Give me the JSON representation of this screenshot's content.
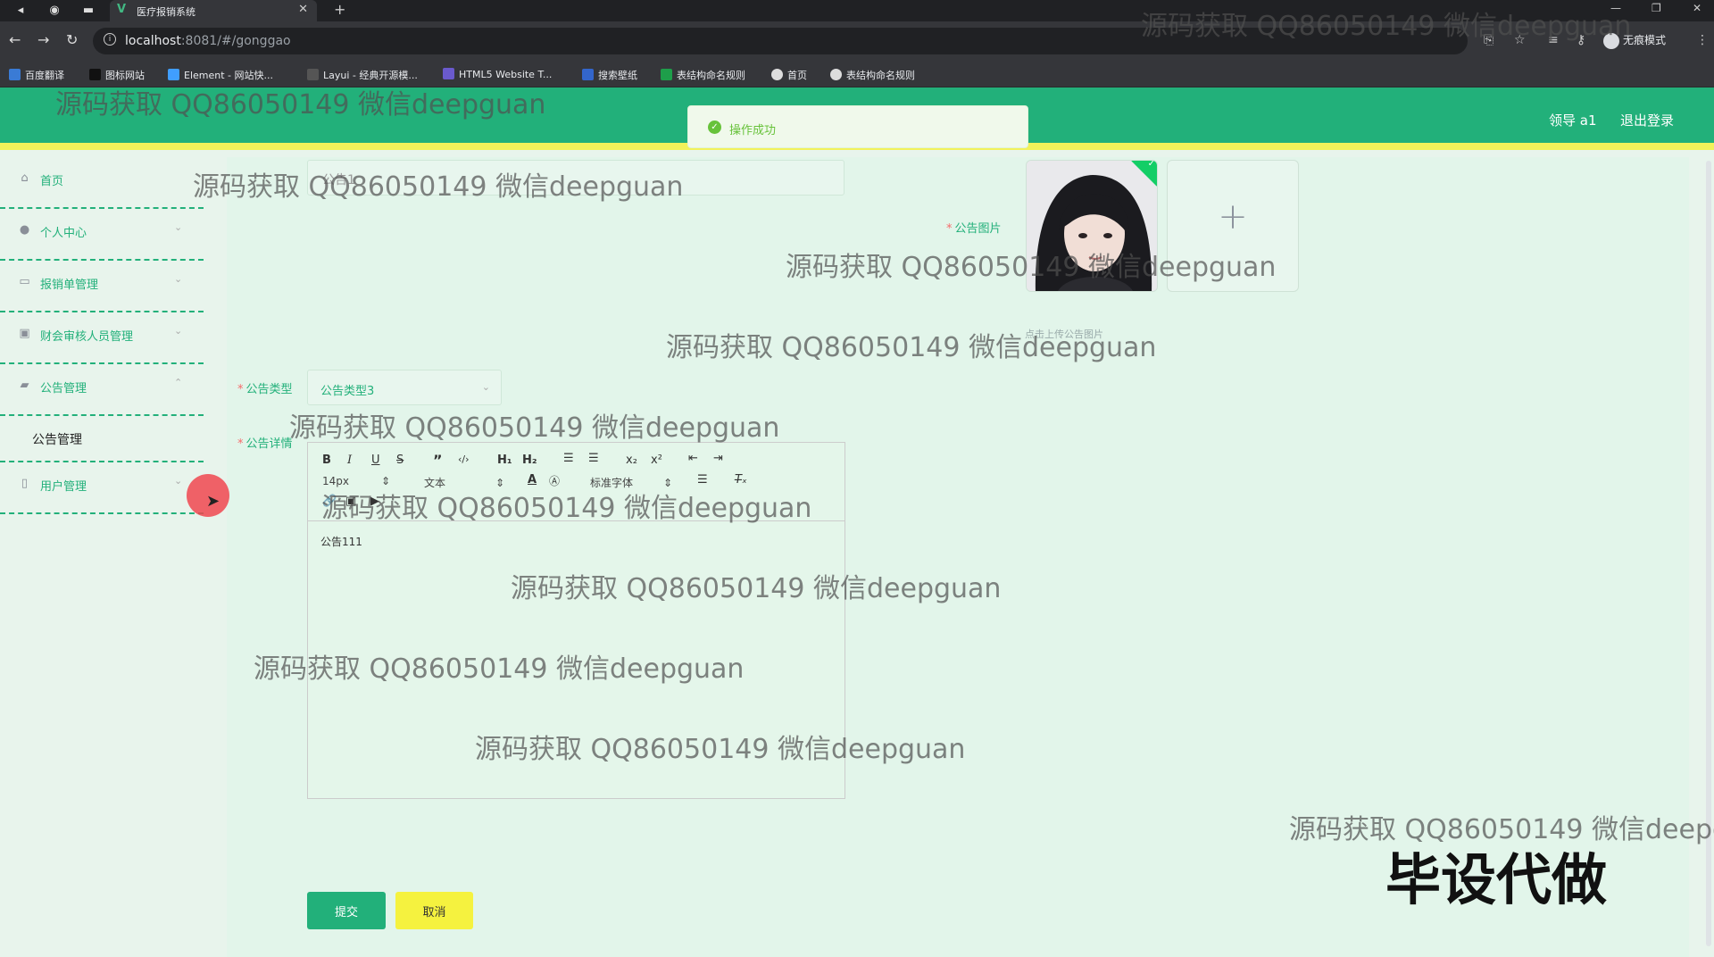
{
  "browser": {
    "tab_title": "医疗报销系统",
    "url_host": "localhost",
    "url_path": ":8081/#/gonggao",
    "profile_label": "无痕模式",
    "bookmarks": [
      "百度翻译",
      "图标网站",
      "Element - 网站快...",
      "Layui - 经典开源模...",
      "HTML5 Website T...",
      "搜索壁纸",
      "表结构命名规则",
      "首页",
      "表结构命名规则"
    ]
  },
  "header": {
    "user_label": "领导 a1",
    "logout_label": "退出登录",
    "accent_color": "#22b07a"
  },
  "toast": {
    "message": "操作成功",
    "status": "success"
  },
  "sidebar": {
    "items": [
      {
        "label": "首页",
        "icon": "home-icon"
      },
      {
        "label": "个人中心",
        "icon": "user-icon"
      },
      {
        "label": "报销单管理",
        "icon": "chat-icon"
      },
      {
        "label": "财会审核人员管理",
        "icon": "edit-icon"
      },
      {
        "label": "公告管理",
        "icon": "message-icon"
      },
      {
        "label": "用户管理",
        "icon": "phone-icon"
      }
    ],
    "submenu_label": "公告管理"
  },
  "form": {
    "title_value": "公告1",
    "image_label": "公告图片",
    "upload_tip": "点击上传公告图片",
    "type_label": "公告类型",
    "type_value": "公告类型3",
    "detail_label": "公告详情",
    "editor": {
      "font_size": "14px",
      "text_type": "文本",
      "font_family": "标准字体",
      "content": "公告111"
    },
    "submit_label": "提交",
    "cancel_label": "取消"
  },
  "watermarks": {
    "line": "源码获取 QQ86050149 微信deepguan",
    "line_cut": "源码获取 QQ86050149 微信deepg",
    "stamp": "毕设代做"
  }
}
